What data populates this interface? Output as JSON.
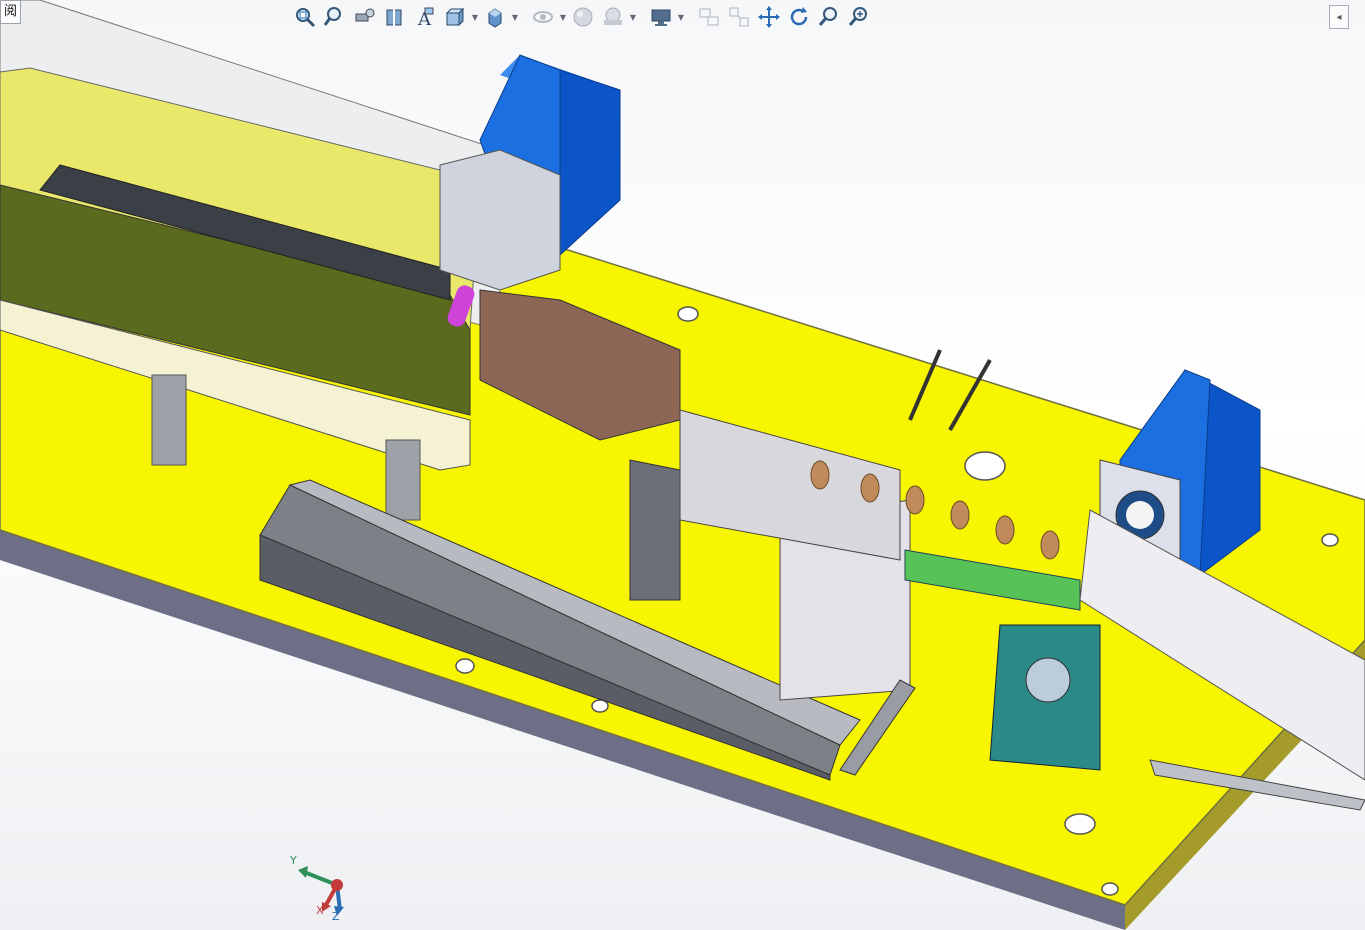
{
  "app": {
    "tab_label": "阅"
  },
  "toolbar": {
    "buttons": [
      {
        "name": "zoom-to-fit-icon",
        "has_dropdown": false
      },
      {
        "name": "zoom-to-area-icon",
        "has_dropdown": false
      },
      {
        "name": "previous-view-icon",
        "has_dropdown": false
      },
      {
        "name": "section-view-icon",
        "has_dropdown": false
      },
      {
        "name": "dynamic-annotation-icon",
        "has_dropdown": false
      },
      {
        "name": "view-orientation-icon",
        "has_dropdown": true
      },
      {
        "name": "display-style-icon",
        "has_dropdown": true
      },
      {
        "name": "hide-show-items-icon",
        "has_dropdown": true
      },
      {
        "name": "edit-appearance-icon",
        "has_dropdown": false
      },
      {
        "name": "apply-scene-icon",
        "has_dropdown": true
      },
      {
        "name": "view-settings-icon",
        "has_dropdown": true
      },
      {
        "name": "rotate-view-icon",
        "has_dropdown": false
      },
      {
        "name": "pan-icon",
        "has_dropdown": false
      },
      {
        "name": "translate-icon",
        "has_dropdown": false
      },
      {
        "name": "rotate-icon",
        "has_dropdown": false
      },
      {
        "name": "zoom-icon",
        "has_dropdown": false
      },
      {
        "name": "zoom-in-icon",
        "has_dropdown": false
      }
    ]
  },
  "colors": {
    "base_plate": "#f7f500",
    "plate_edge": "#9a9a6a",
    "motor_blue": "#1b6fe0",
    "feeder_olive": "#5a6a1e",
    "rails_gray": "#7e8088",
    "roller_copper": "#c08a5a",
    "bracket_teal": "#2a8a88",
    "mount_green": "#56c257",
    "block_brown": "#8e6656",
    "accent_magenta": "#cf43d8"
  },
  "triad": {
    "x_label": "X",
    "y_label": "Y",
    "z_label": "Z"
  }
}
